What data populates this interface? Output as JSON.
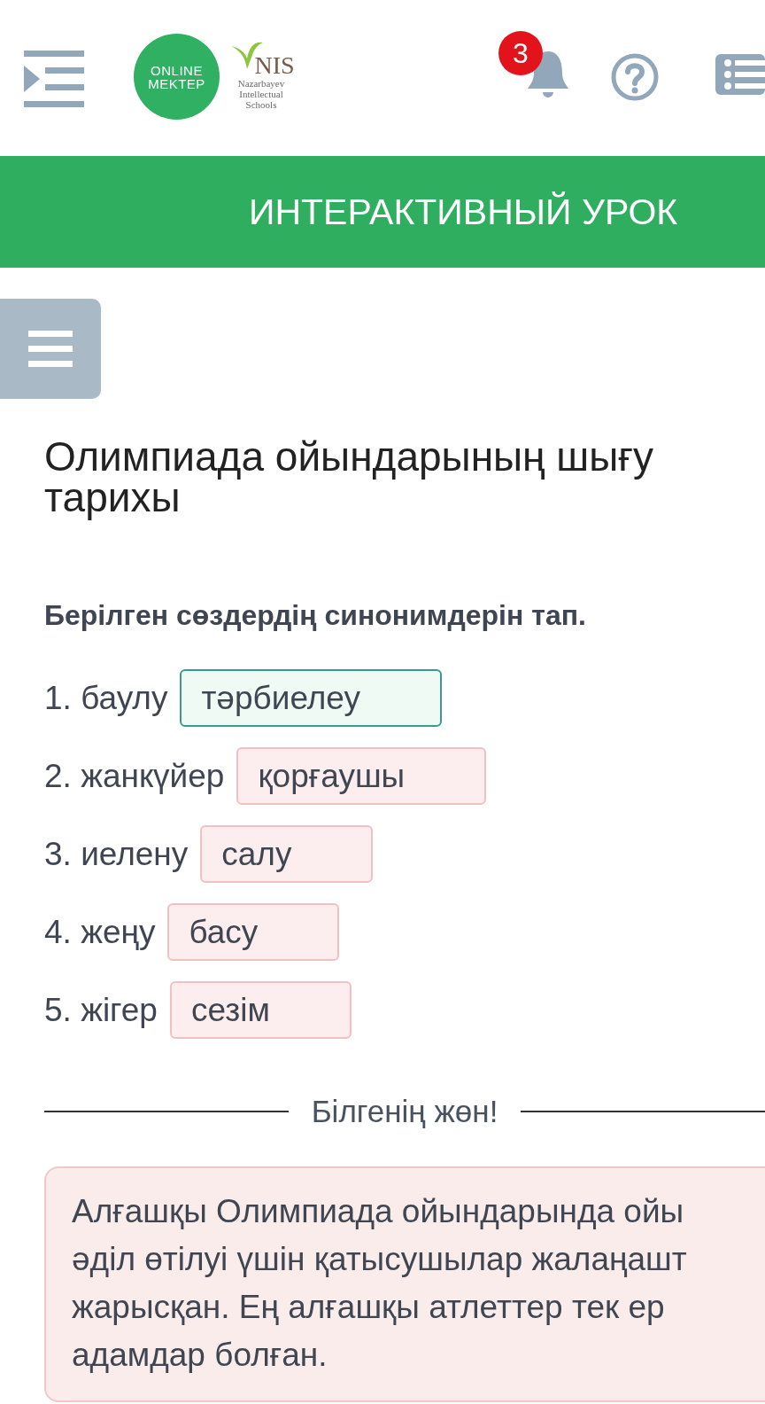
{
  "header": {
    "logo": {
      "circle_lines": [
        "ONLINE",
        "MEKTEP"
      ],
      "brand": "NIS",
      "sub_lines": [
        "Nazarbayev",
        "Intellectual",
        "Schools"
      ]
    },
    "notifications_badge": "3"
  },
  "banner": {
    "title": "ИНТЕРАКТИВНЫЙ УРОК"
  },
  "lesson": {
    "title_lines": [
      "Олимпиада ойындарының шығу",
      "тарихы"
    ],
    "instruction": "Берілген сөздердің синонимдерін тап.",
    "items": [
      {
        "label": "1. баулу",
        "answer": "тәрбиелеу",
        "correct": true
      },
      {
        "label": "2. жанкүйер",
        "answer": "қорғаушы",
        "correct": false
      },
      {
        "label": "3. иелену",
        "answer": "салу",
        "correct": false
      },
      {
        "label": "4. жеңу",
        "answer": "басу",
        "correct": false
      },
      {
        "label": "5. жігер",
        "answer": "сезім",
        "correct": false
      }
    ],
    "divider_title": "Білгенің жөн!",
    "fact_lines": [
      "Алғашқы Олимпиада ойындарында ойы",
      "әділ өтілуі үшін қатысушылар жалаңашт",
      "жарысқан. Ең алғашқы атлеттер тек ер",
      "адамдар болған."
    ]
  }
}
